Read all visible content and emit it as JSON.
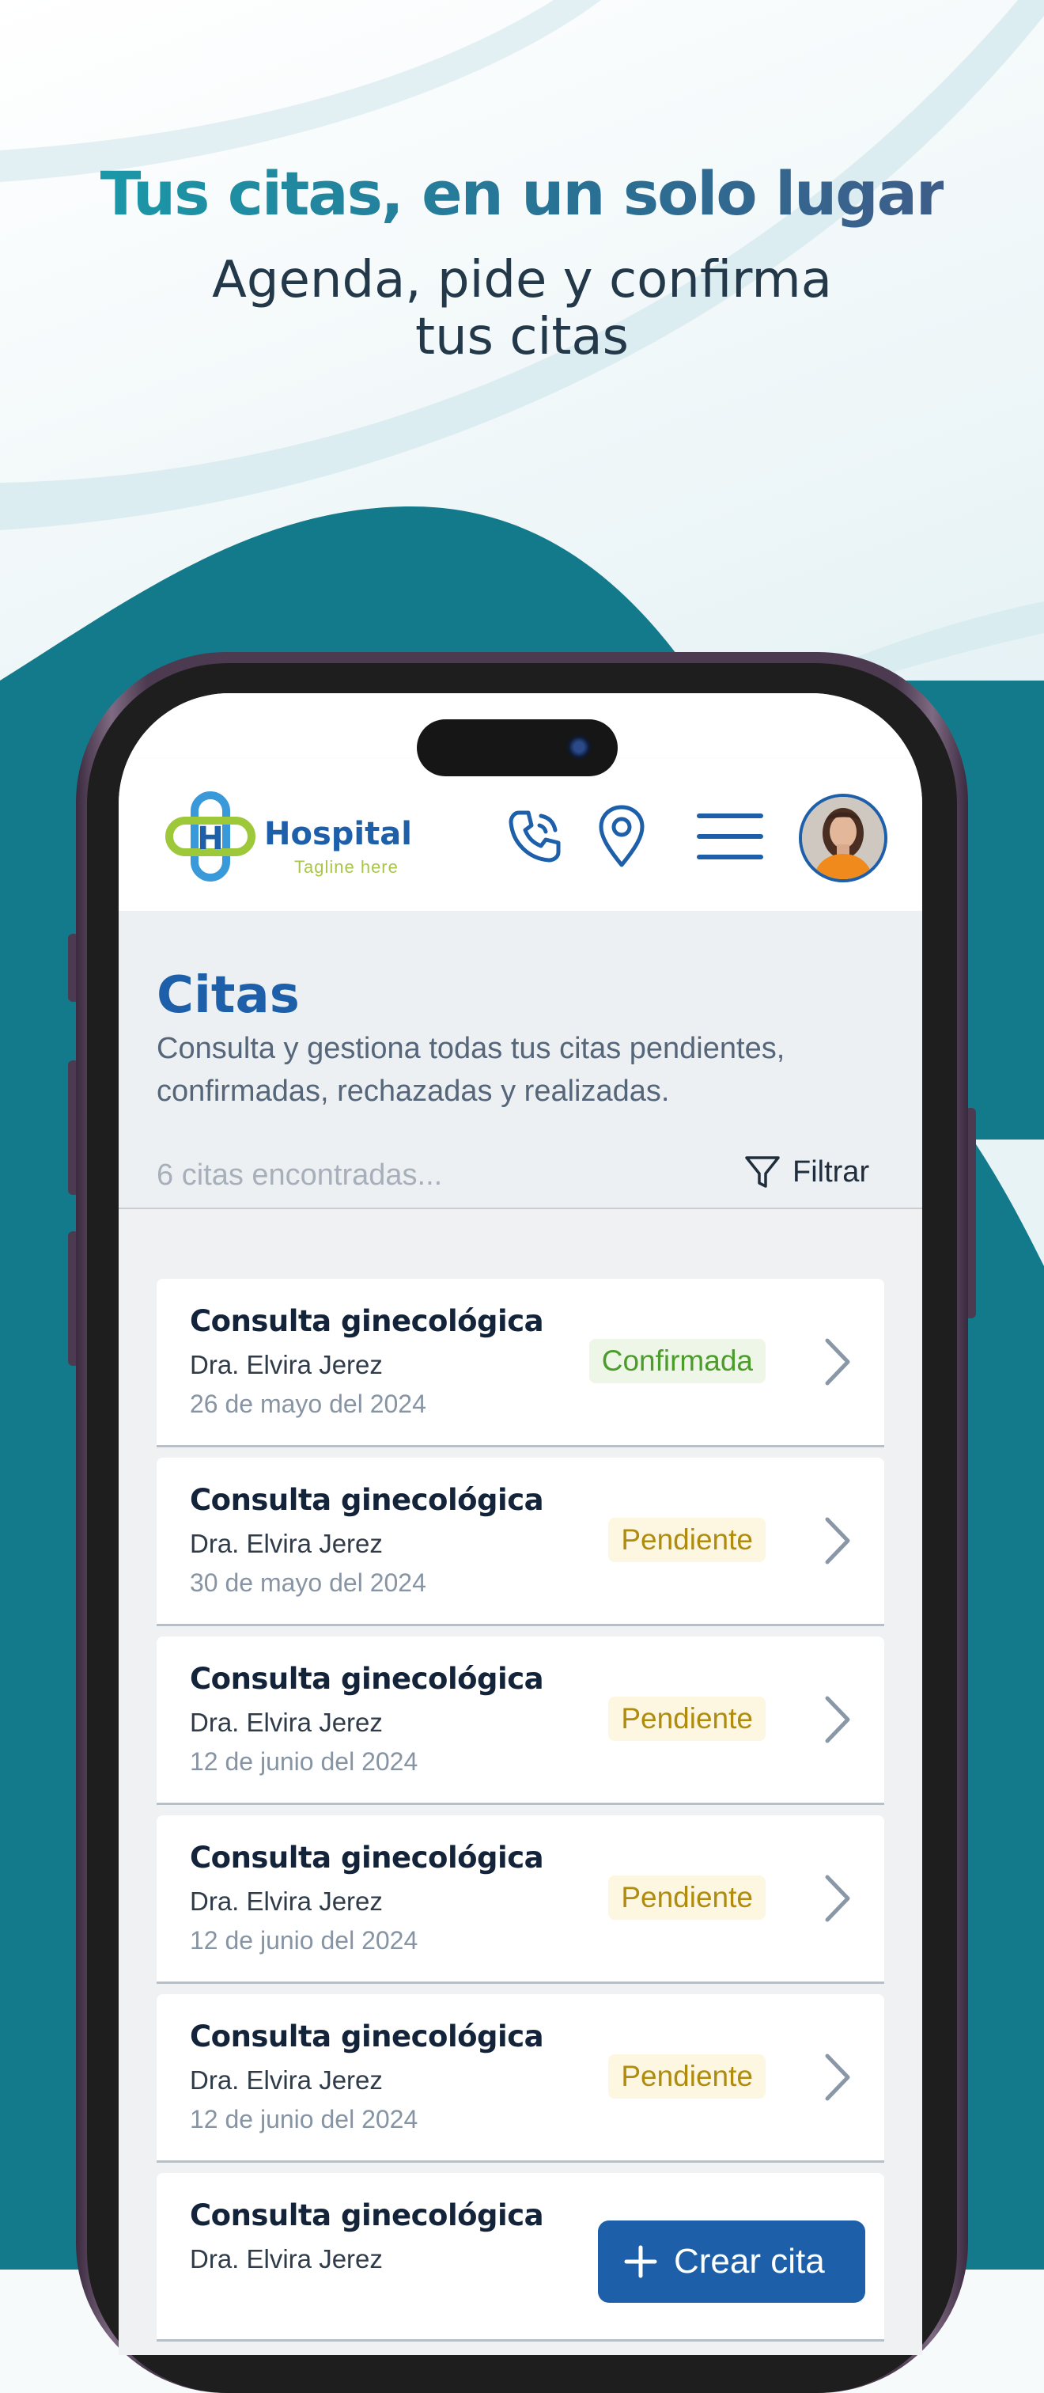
{
  "promo": {
    "headline": "Tus citas, en un solo lugar",
    "subline_1": "Agenda, pide y confirma",
    "subline_2": "tus citas"
  },
  "app": {
    "logo_text": "Hospital",
    "logo_tagline": "Tagline here",
    "icons": [
      "phone-icon",
      "location-pin-icon",
      "menu-icon",
      "user-avatar"
    ],
    "page_title": "Citas",
    "description": "Consulta y gestiona todas tus citas pendientes, confirmadas, rechazadas y realizadas.",
    "results_count": "6 citas encontradas...",
    "filter_label": "Filtrar",
    "appointments": [
      {
        "title": "Consulta ginecológica",
        "doctor": "Dra. Elvira Jerez",
        "date": "26 de mayo del 2024",
        "status": "Confirmada"
      },
      {
        "title": "Consulta ginecológica",
        "doctor": "Dra. Elvira Jerez",
        "date": "30 de mayo del 2024",
        "status": "Pendiente"
      },
      {
        "title": "Consulta ginecológica",
        "doctor": "Dra. Elvira Jerez",
        "date": "12 de junio del 2024",
        "status": "Pendiente"
      },
      {
        "title": "Consulta ginecológica",
        "doctor": "Dra. Elvira Jerez",
        "date": "12 de junio del 2024",
        "status": "Pendiente"
      },
      {
        "title": "Consulta ginecológica",
        "doctor": "Dra. Elvira Jerez",
        "date": "12 de junio del 2024",
        "status": "Pendiente"
      },
      {
        "title": "Consulta ginecológica",
        "doctor": "Dra. Elvira Jerez",
        "date": "",
        "status": ""
      }
    ],
    "create_button": "Crear cita"
  },
  "colors": {
    "brand_blue": "#1d5fa8",
    "teal_bg": "#137a8c",
    "confirmed": "#4b9c2b",
    "pending": "#b08c0e"
  }
}
